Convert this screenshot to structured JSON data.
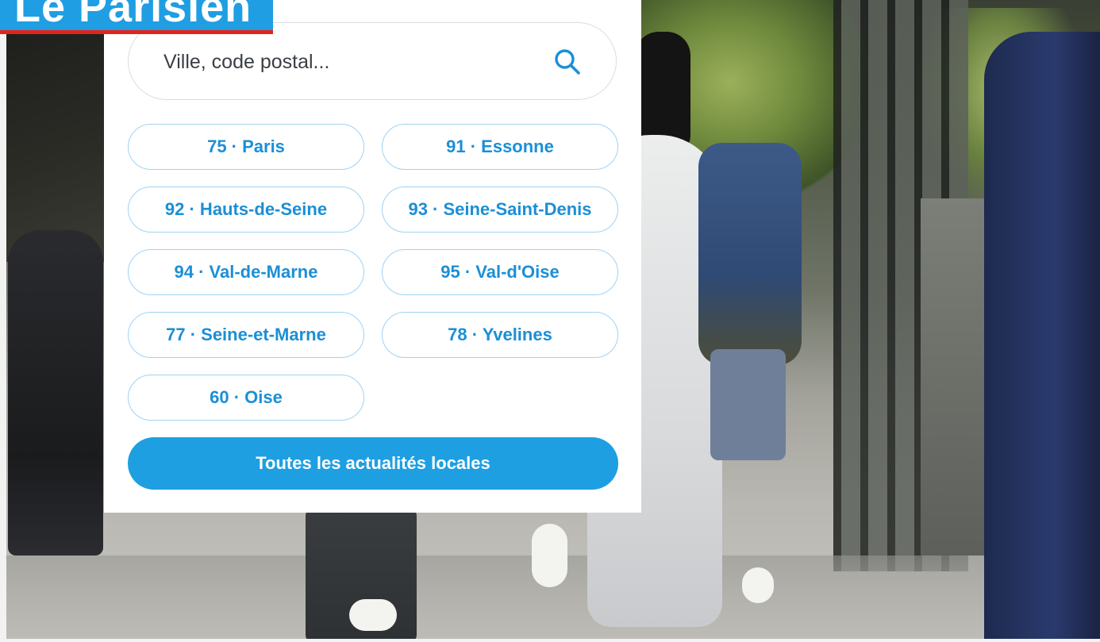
{
  "logo": {
    "text": "Le Parisien",
    "colors": {
      "background": "#1f9ee3",
      "underline": "#e2231a",
      "text": "#ffffff"
    }
  },
  "search": {
    "placeholder": "Ville, code postal...",
    "value": "",
    "icon": "search-icon"
  },
  "departments": [
    {
      "label": "75 · Paris"
    },
    {
      "label": "91 · Essonne"
    },
    {
      "label": "92 · Hauts-de-Seine"
    },
    {
      "label": "93 · Seine-Saint-Denis"
    },
    {
      "label": "94 · Val-de-Marne"
    },
    {
      "label": "95 · Val-d'Oise"
    },
    {
      "label": "77 · Seine-et-Marne"
    },
    {
      "label": "78 · Yvelines"
    },
    {
      "label": "60 · Oise"
    }
  ],
  "all_news_button": {
    "label": "Toutes les actualités locales"
  },
  "theme": {
    "accent": "#1e9fe2",
    "pill_border": "#9fd3f2",
    "pill_text": "#1b8fd6"
  }
}
